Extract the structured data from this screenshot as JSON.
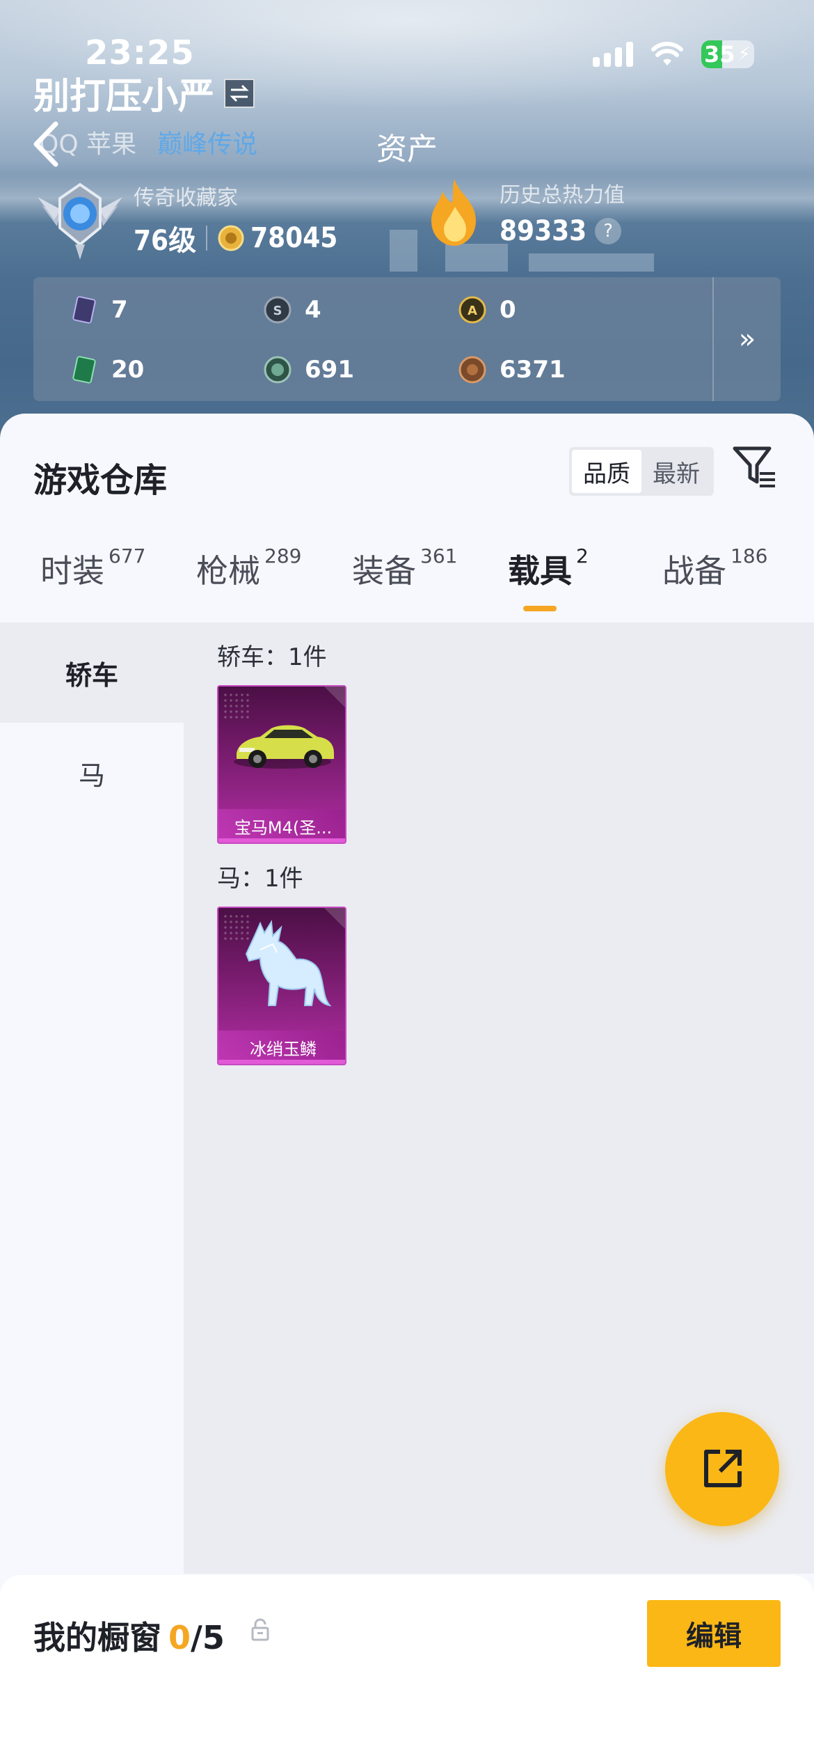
{
  "status_bar": {
    "time": "23:25",
    "battery": "35"
  },
  "nav": {
    "title": "资产"
  },
  "profile": {
    "username": "别打压小严",
    "platform": "QQ 苹果",
    "tag": "巅峰传说"
  },
  "collector": {
    "title": "传奇收藏家",
    "level": "76级",
    "coins": "78045"
  },
  "heat": {
    "label": "历史总热力值",
    "value": "89333",
    "help": "?"
  },
  "stats": [
    {
      "icon": "card-icon",
      "value": "7",
      "color": "#3e3a6e"
    },
    {
      "icon": "s-badge-icon",
      "value": "4",
      "color": "#2f3a46"
    },
    {
      "icon": "a-badge-icon",
      "value": "0",
      "color": "#6b5a16"
    },
    {
      "icon": "green-card-icon",
      "value": "20",
      "color": "#1f7a4a"
    },
    {
      "icon": "gem-icon",
      "value": "691",
      "color": "#2e5448"
    },
    {
      "icon": "bronze-coin-icon",
      "value": "6371",
      "color": "#7a4a2a"
    }
  ],
  "stats_more": "»",
  "warehouse": {
    "title": "游戏仓库",
    "sort_options": [
      "品质",
      "最新"
    ],
    "active_sort": "品质"
  },
  "tabs": [
    {
      "label": "时装",
      "count": "677"
    },
    {
      "label": "枪械",
      "count": "289"
    },
    {
      "label": "装备",
      "count": "361"
    },
    {
      "label": "载具",
      "count": "2"
    },
    {
      "label": "战备",
      "count": "186"
    }
  ],
  "active_tab": "载具",
  "categories": [
    "轿车",
    "马"
  ],
  "active_category": "轿车",
  "groups": [
    {
      "header": "轿车：1件",
      "items": [
        {
          "name": "宝马M4(圣...",
          "kind": "car"
        }
      ]
    },
    {
      "header": "马：1件",
      "items": [
        {
          "name": "冰绡玉鳞",
          "kind": "horse"
        }
      ]
    }
  ],
  "showcase": {
    "label": "我的橱窗",
    "current": "0",
    "total": "/5",
    "edit": "编辑"
  },
  "colors": {
    "accent": "#fbb715",
    "tab_underline": "#f5a623",
    "card_purple": "#b22fa4"
  }
}
